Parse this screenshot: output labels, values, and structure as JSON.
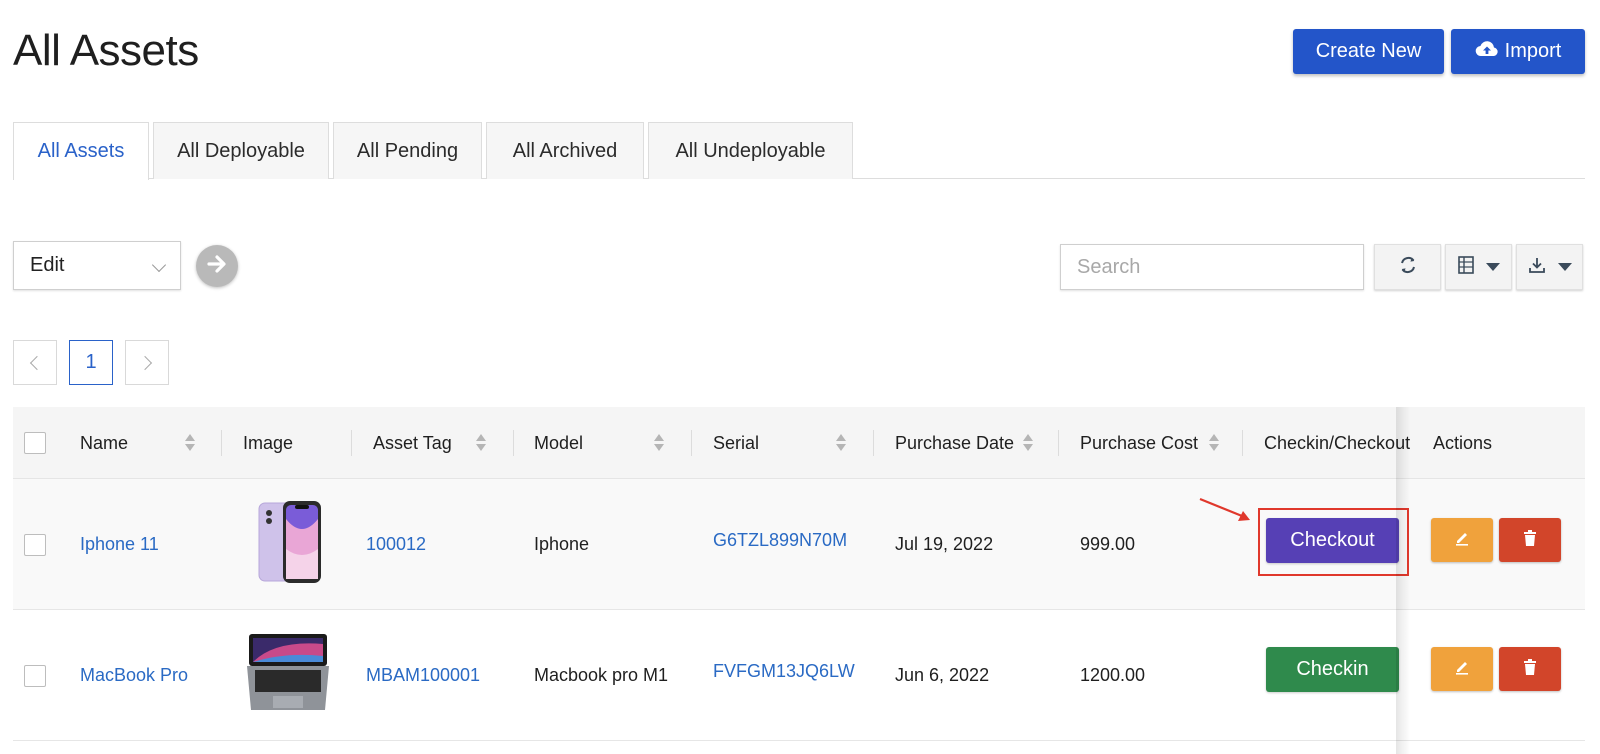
{
  "header": {
    "title": "All Assets",
    "create_label": "Create New",
    "import_label": "Import"
  },
  "tabs": [
    {
      "label": "All Assets",
      "active": true
    },
    {
      "label": "All Deployable",
      "active": false
    },
    {
      "label": "All Pending",
      "active": false
    },
    {
      "label": "All Archived",
      "active": false
    },
    {
      "label": "All Undeployable",
      "active": false
    }
  ],
  "toolbar": {
    "bulk_action_value": "Edit",
    "search_placeholder": "Search",
    "icons": [
      "arrow-right-circle-icon",
      "refresh-icon",
      "columns-icon",
      "download-icon",
      "caret-down-icon"
    ]
  },
  "pagination": {
    "current_page": "1"
  },
  "table": {
    "columns": [
      "Name",
      "Image",
      "Asset Tag",
      "Model",
      "Serial",
      "Purchase Date",
      "Purchase Cost",
      "Checkin/Checkout",
      "Actions"
    ],
    "rows": [
      {
        "name": "Iphone 11",
        "image": "iphone-image",
        "asset_tag": "100012",
        "model": "Iphone",
        "serial": "G6TZL899N70M",
        "purchase_date": "Jul 19, 2022",
        "purchase_cost": "999.00",
        "checkin_checkout": "Checkout",
        "action_color": "#5640b5"
      },
      {
        "name": "MacBook Pro",
        "image": "macbook-image",
        "asset_tag": "MBAM100001",
        "model": "Macbook pro M1",
        "serial": "FVFGM13JQ6LW",
        "purchase_date": "Jun 6, 2022",
        "purchase_cost": "1200.00",
        "checkin_checkout": "Checkin",
        "action_color": "#2f8a4c"
      }
    ]
  },
  "colors": {
    "primary": "#2355c9",
    "link": "#2a6ac4",
    "checkout": "#5640b5",
    "checkin": "#2f8a4c",
    "edit": "#f0a23c",
    "delete": "#d2452a",
    "annotation": "#e0382c"
  }
}
